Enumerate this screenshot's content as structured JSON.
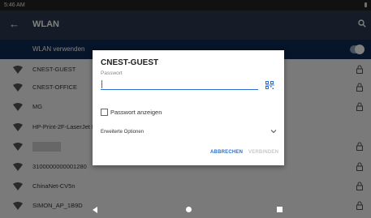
{
  "status_bar": {
    "time": "5:46 AM"
  },
  "app_bar": {
    "title": "WLAN"
  },
  "toggle_row": {
    "label": "WLAN verwenden",
    "enabled": true
  },
  "networks": [
    {
      "ssid": "CNEST-GUEST",
      "secured": true
    },
    {
      "ssid": "CNEST-OFFICE",
      "secured": true
    },
    {
      "ssid": "MG",
      "secured": true
    },
    {
      "ssid": "HP-Print-2F-LaserJet Pr",
      "secured": false
    },
    {
      "ssid": "",
      "secured": true
    },
    {
      "ssid": "3100000000001280",
      "secured": true
    },
    {
      "ssid": "ChinaNet-CV5n",
      "secured": true
    },
    {
      "ssid": "SIMON_AP_1B9D",
      "secured": true
    }
  ],
  "dialog": {
    "title": "CNEST-GUEST",
    "password_label": "Passwort",
    "password_value": "",
    "show_password_label": "Passwort anzeigen",
    "show_password_checked": false,
    "advanced_label": "Erweiterte Optionen",
    "cancel_label": "ABBRECHEN",
    "connect_label": "VERBINDEN"
  },
  "colors": {
    "app_bar": "#2b3950",
    "toggle_row": "#0e2a55",
    "accent": "#2b6fd6",
    "button": "#2f6fcb",
    "disabled": "#c8c8c8"
  }
}
